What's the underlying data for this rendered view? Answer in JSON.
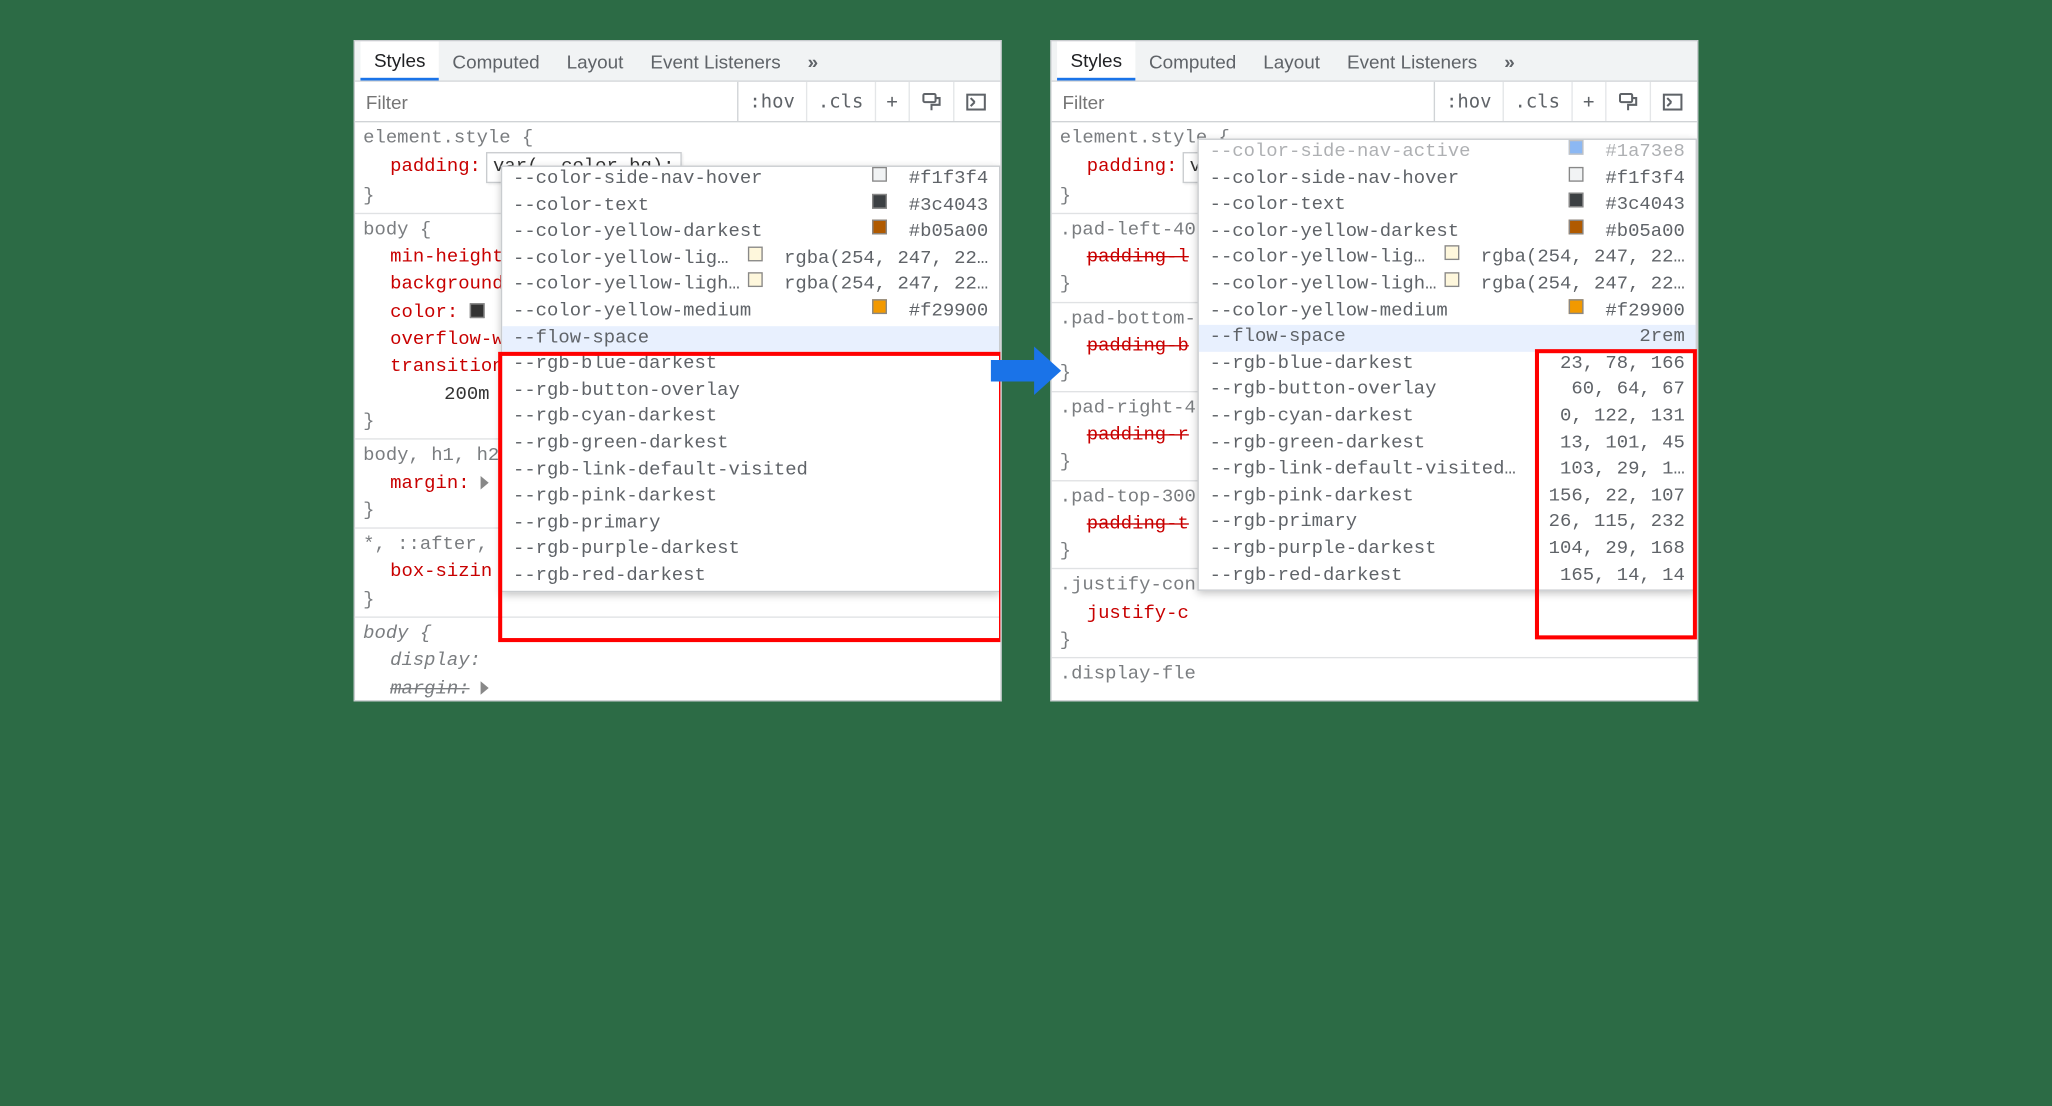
{
  "tabs": {
    "styles": "Styles",
    "computed": "Computed",
    "layout": "Layout",
    "listeners": "Event Listeners",
    "more": "»"
  },
  "toolbar": {
    "filter_placeholder": "Filter",
    "hov": ":hov",
    "cls": ".cls",
    "plus": "+"
  },
  "element_style": {
    "selector": "element.style {",
    "prop": "padding:",
    "value": "var(--color-bg);",
    "close": "}"
  },
  "left_rules": [
    {
      "selector": "body {",
      "props": [
        {
          "name": "min-height",
          "extra": ""
        },
        {
          "name": "background",
          "extra": ""
        },
        {
          "name": "color:",
          "extra": "swatch"
        },
        {
          "name": "overflow-w",
          "extra": ""
        },
        {
          "name": "transition",
          "extra": ""
        }
      ],
      "tail": "200m",
      "close": "}"
    },
    {
      "selector": "body, h1, h2",
      "props": [
        {
          "name": "margin:",
          "extra": "tri"
        }
      ],
      "close": "}"
    },
    {
      "selector": "*, ::after,",
      "props": [
        {
          "name": "box-sizin",
          "extra": ""
        }
      ],
      "close": "}"
    },
    {
      "selector_italic": "body {",
      "props_italic": [
        {
          "name": "display:",
          "strike": false
        },
        {
          "name": "margin:",
          "strike": true,
          "tri": true
        }
      ]
    }
  ],
  "right_rules": [
    {
      "selector": ".pad-left-40",
      "prop": "padding-l",
      "strike": true,
      "close": "}"
    },
    {
      "selector": ".pad-bottom-",
      "prop": "padding-b",
      "strike": true,
      "close": "}"
    },
    {
      "selector": ".pad-right-4",
      "prop": "padding-r",
      "strike": true,
      "close": "}"
    },
    {
      "selector": ".pad-top-300",
      "prop": "padding-t",
      "strike": true,
      "close": "}"
    },
    {
      "selector": ".justify-con",
      "prop": "justify-c",
      "strike": false
    },
    {
      "selector": ".display-fle"
    }
  ],
  "popup_top": [
    {
      "name": "--color-side-nav-active",
      "swatch": "#1a73e8",
      "val": "#1a73e8",
      "partial": true
    },
    {
      "name": "--color-side-nav-hover",
      "swatch": "#f1f3f4",
      "val": "#f1f3f4"
    },
    {
      "name": "--color-text",
      "swatch": "#3c4043",
      "val": "#3c4043"
    },
    {
      "name": "--color-yellow-darkest",
      "swatch": "#b05a00",
      "val": "#b05a00"
    },
    {
      "name": "--color-yellow-lig…",
      "swatch": "rgba(254,247,220,1)",
      "val": "rgba(254, 247, 22…"
    },
    {
      "name": "--color-yellow-ligh…",
      "swatch": "rgba(254,247,220,1)",
      "val": "rgba(254, 247, 22…"
    },
    {
      "name": "--color-yellow-medium",
      "swatch": "#f29900",
      "val": "#f29900"
    }
  ],
  "popup_bottom_left": [
    {
      "name": "--flow-space",
      "sel": true
    },
    {
      "name": "--rgb-blue-darkest"
    },
    {
      "name": "--rgb-button-overlay"
    },
    {
      "name": "--rgb-cyan-darkest"
    },
    {
      "name": "--rgb-green-darkest"
    },
    {
      "name": "--rgb-link-default-visited"
    },
    {
      "name": "--rgb-pink-darkest"
    },
    {
      "name": "--rgb-primary"
    },
    {
      "name": "--rgb-purple-darkest"
    },
    {
      "name": "--rgb-red-darkest"
    }
  ],
  "popup_bottom_right": [
    {
      "name": "--flow-space",
      "val": "2rem",
      "sel": true
    },
    {
      "name": "--rgb-blue-darkest",
      "val": "23, 78, 166"
    },
    {
      "name": "--rgb-button-overlay",
      "val": "60, 64, 67"
    },
    {
      "name": "--rgb-cyan-darkest",
      "val": "0, 122, 131"
    },
    {
      "name": "--rgb-green-darkest",
      "val": "13, 101, 45"
    },
    {
      "name": "--rgb-link-default-visited…",
      "val": "103, 29, 1…"
    },
    {
      "name": "--rgb-pink-darkest",
      "val": "156, 22, 107"
    },
    {
      "name": "--rgb-primary",
      "val": "26, 115, 232"
    },
    {
      "name": "--rgb-purple-darkest",
      "val": "104, 29, 168"
    },
    {
      "name": "--rgb-red-darkest",
      "val": "165, 14, 14"
    }
  ]
}
